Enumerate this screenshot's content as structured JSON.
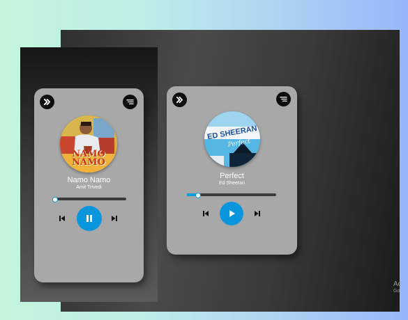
{
  "players": [
    {
      "title": "Namo Namo",
      "artist": "Amit Trivedi",
      "cover_text": [
        "NAMO",
        "NAMO"
      ],
      "progress": 0.02,
      "state": "playing",
      "accent": "#0a96dc"
    },
    {
      "title": "Perfect",
      "artist": "Ed Sheeran",
      "cover_text": [
        "ED SHEERAN",
        "Perfect"
      ],
      "progress": 0.12,
      "state": "paused",
      "accent": "#0a96dc"
    }
  ],
  "icons": {
    "top_left": "double-chevron-right-icon",
    "top_right": "menu-icon",
    "prev": "skip-previous-icon",
    "next": "skip-next-icon",
    "pause": "pause-icon",
    "play": "play-icon"
  },
  "watermark": {
    "line1": "Ac",
    "line2": "Go"
  }
}
